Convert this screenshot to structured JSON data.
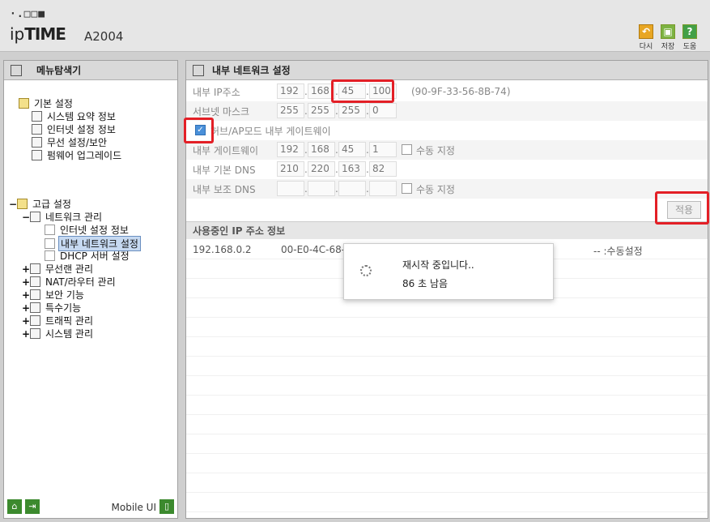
{
  "header": {
    "logo_dots": "·.□□■",
    "brand_ip": "ip",
    "brand_time": "TIME",
    "model": "A2004",
    "buttons": [
      {
        "label": "다시",
        "icon": "undo-icon",
        "color": "#e8a623"
      },
      {
        "label": "저장",
        "icon": "save-icon",
        "color": "#7cb342"
      },
      {
        "label": "도움",
        "icon": "help-icon",
        "color": "#43a047"
      }
    ]
  },
  "sidebar": {
    "title": "메뉴탐색기",
    "basic": {
      "label": "기본 설정",
      "items": [
        "시스템 요약 정보",
        "인터넷 설정 정보",
        "무선 설정/보안",
        "펌웨어 업그레이드"
      ]
    },
    "advanced": {
      "label": "고급 설정",
      "network": {
        "label": "네트워크 관리",
        "items": [
          "인터넷 설정 정보",
          "내부 네트워크 설정",
          "DHCP 서버 설정"
        ]
      },
      "others": [
        "무선랜 관리",
        "NAT/라우터 관리",
        "보안 기능",
        "특수기능",
        "트래픽 관리",
        "시스템 관리"
      ]
    },
    "footer": {
      "mobile": "Mobile UI"
    }
  },
  "main": {
    "title": "내부 네트워크 설정",
    "ip_label": "내부 IP주소",
    "ip": [
      "192",
      "168",
      "45",
      "100"
    ],
    "mac": "(90-9F-33-56-8B-74)",
    "subnet_label": "서브넷 마스크",
    "subnet": [
      "255",
      "255",
      "255",
      "0"
    ],
    "hub_label": "허브/AP모드 내부 게이트웨이",
    "gw_label": "내부 게이트웨이",
    "gw": [
      "192",
      "168",
      "45",
      "1"
    ],
    "manual_label": "수동 지정",
    "dns1_label": "내부 기본 DNS",
    "dns1": [
      "210",
      "220",
      "163",
      "82"
    ],
    "dns2_label": "내부 보조 DNS",
    "dns2": [
      "",
      "",
      "",
      ""
    ],
    "apply": "적용",
    "list_title": "사용중인 IP 주소 정보",
    "list_row": {
      "ip": "192.168.0.2",
      "mac": "00-E0-4C-68-4",
      "status": "-- :수동설정"
    }
  },
  "dialog": {
    "line1": "재시작 중입니다..",
    "line2": "86 초 남음"
  }
}
